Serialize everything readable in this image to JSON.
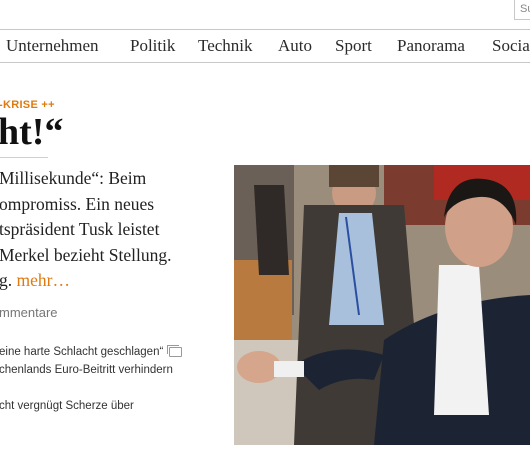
{
  "search": {
    "placeholder": "Su"
  },
  "nav": {
    "items": [
      "Unternehmen",
      "Politik",
      "Technik",
      "Auto",
      "Sport",
      "Panorama",
      "Socia"
    ]
  },
  "article": {
    "kicker": "-KRISE ++",
    "headline": "ht!“",
    "teaser_lines": [
      "Millisekunde“: Beim",
      "ompromiss. Ein neues",
      "tspräsident Tusk leistet",
      "Merkel bezieht Stellung."
    ],
    "teaser_last_prefix": "g.",
    "more_label": "mehr…",
    "comments_label": "mmentare",
    "related": [
      {
        "text": "eine harte Schlacht geschlagen“",
        "has_gallery_icon": true
      },
      {
        "text": "chenlands Euro-Beitritt verhindern",
        "has_gallery_icon": false
      },
      {
        "text": "cht vergnügt Scherze über",
        "has_gallery_icon": false
      }
    ]
  },
  "colors": {
    "accent": "#e07a10",
    "border": "#c8c8c8"
  }
}
